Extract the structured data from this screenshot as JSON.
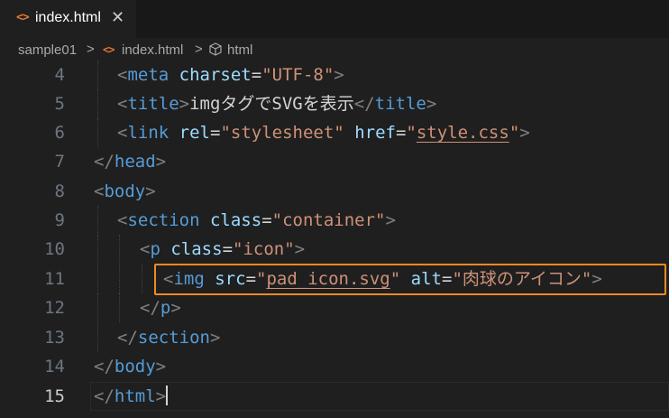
{
  "tab": {
    "icon": "<>",
    "label": "index.html",
    "close": "✕"
  },
  "breadcrumb": {
    "folder": "sample01",
    "file": "index.html",
    "symbol": "html",
    "sep": ">"
  },
  "editor": {
    "lines": [
      {
        "num": "4"
      },
      {
        "num": "5"
      },
      {
        "num": "6"
      },
      {
        "num": "7"
      },
      {
        "num": "8"
      },
      {
        "num": "9"
      },
      {
        "num": "10"
      },
      {
        "num": "11"
      },
      {
        "num": "12"
      },
      {
        "num": "13"
      },
      {
        "num": "14"
      },
      {
        "num": "15"
      }
    ],
    "meta_attr": "charset",
    "meta_val": "\"UTF-8\"",
    "title_text": "imgタグでSVGを表示",
    "link_rel": "\"stylesheet\"",
    "link_href_q1": "\"",
    "link_href": "style.css",
    "link_href_q2": "\"",
    "section_class": "\"container\"",
    "p_class": "\"icon\"",
    "img_src": "pad_icon.svg",
    "img_alt": "\"肉球のアイコン\"",
    "accent": "#f08a24"
  }
}
